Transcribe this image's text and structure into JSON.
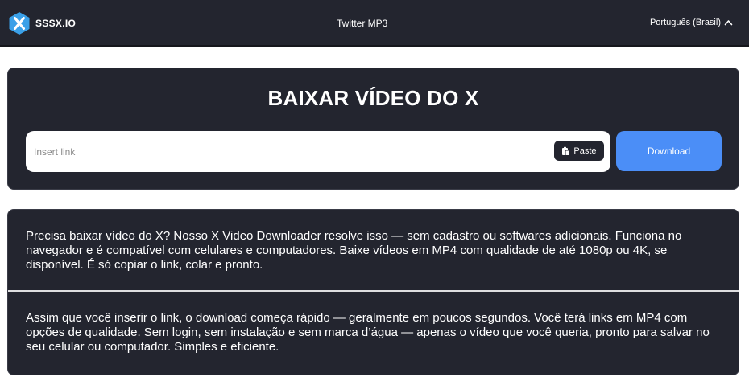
{
  "navbar": {
    "brand": "SSSX.IO",
    "brand_icon": "x-hexagon-logo-icon",
    "nav_link": "Twitter MP3",
    "language": "Português (Brasil)",
    "language_icon": "chevron-up-icon"
  },
  "hero": {
    "title": "BAIXAR VÍDEO DO X",
    "input_placeholder": "Insert link",
    "input_value": "",
    "paste_label": "Paste",
    "paste_icon": "clipboard-icon",
    "download_label": "Download"
  },
  "info": {
    "paragraph1": "Precisa baixar vídeo do X? Nosso X Video Downloader resolve isso — sem cadastro ou softwares adicionais. Funciona no navegador e é compatível com celulares e computadores. Baixe vídeos em MP4 com qualidade de até 1080p ou 4K, se disponível. É só copiar o link, colar e pronto.",
    "paragraph2": "Assim que você inserir o link, o download começa rápido — geralmente em poucos segundos. Você terá links em MP4 com opções de qualidade. Sem login, sem instalação e sem marca d’água — apenas o vídeo que você queria, pronto para salvar no seu celular ou computador. Simples e eficiente."
  },
  "colors": {
    "background": "#ffffff",
    "panel": "#23252f",
    "accent": "#4b8ef7",
    "logo": "#3aa0e8"
  }
}
